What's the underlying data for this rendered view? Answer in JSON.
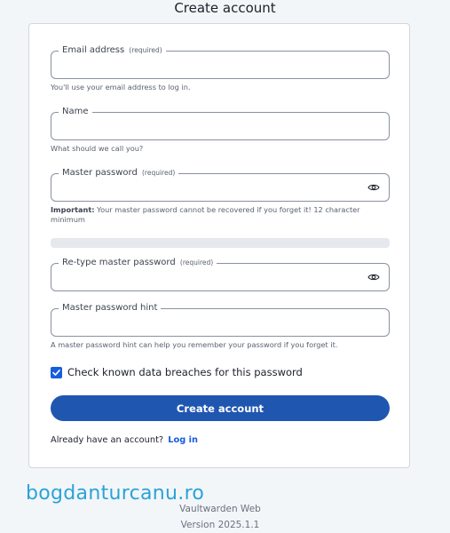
{
  "page": {
    "title": "Create account"
  },
  "form": {
    "email": {
      "label": "Email address",
      "required_tag": "(required)",
      "value": "",
      "help": "You'll use your email address to log in."
    },
    "name": {
      "label": "Name",
      "value": "",
      "help": "What should we call you?"
    },
    "master_password": {
      "label": "Master password",
      "required_tag": "(required)",
      "value": "",
      "help_bold": "Important:",
      "help": " Your master password cannot be recovered if you forget it! 12 character minimum"
    },
    "strength": {
      "level": 0
    },
    "retype_password": {
      "label": "Re-type master password",
      "required_tag": "(required)",
      "value": ""
    },
    "hint": {
      "label": "Master password hint",
      "value": "",
      "help": "A master password hint can help you remember your password if you forget it."
    },
    "breach_check": {
      "label": "Check known data breaches for this password",
      "checked": true
    },
    "submit_label": "Create account",
    "login_prompt": "Already have an account?",
    "login_link": "Log in"
  },
  "watermark": "bogdanturcanu.ro",
  "footer": {
    "app_name": "Vaultwarden Web",
    "version": "Version 2025.1.1"
  },
  "colors": {
    "primary": "#1f56b0",
    "link": "#175ddc",
    "watermark": "#2aa3d8"
  }
}
